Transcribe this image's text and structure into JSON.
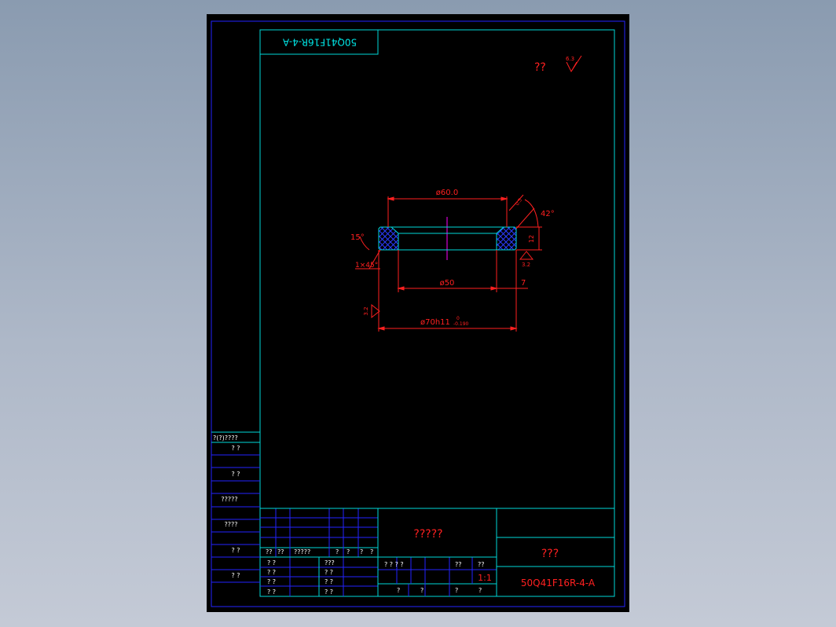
{
  "drawing": {
    "stamp_top": "50Q41F16R-4-A",
    "surface_mark": "??",
    "roughness_top": "6.3",
    "dim_top": "ø60.0",
    "chamfer_top": "0.5",
    "angle_right": "42°",
    "height": "12",
    "roughness_right": "3.2",
    "angle_left": "15°",
    "chamfer_left": "1×45°",
    "dim_inner": "ø50",
    "width": "7",
    "roughness_left": "3.2",
    "dim_outer": "ø70h11",
    "tol_upper": "0",
    "tol_lower": "-0.190"
  },
  "side_table": {
    "header": "?(?)????",
    "rows": [
      "?   ?",
      "?   ?",
      "?????",
      "????",
      "?   ?",
      "?   ?"
    ]
  },
  "title_block": {
    "material": "?????",
    "name": "???",
    "drawing_no": "50Q41F16R-4-A",
    "scale": "1:1",
    "revision_headers": [
      "??",
      "??",
      "?????",
      "?",
      "?",
      "?",
      "?"
    ],
    "signature_labels": [
      "? ?",
      "? ?",
      "? ?",
      "? ?",
      "???",
      "? ?",
      "? ?",
      "? ?"
    ],
    "info_labels": [
      "? ? ? ?",
      "??",
      "??",
      "?",
      "?",
      "?",
      "?"
    ]
  }
}
